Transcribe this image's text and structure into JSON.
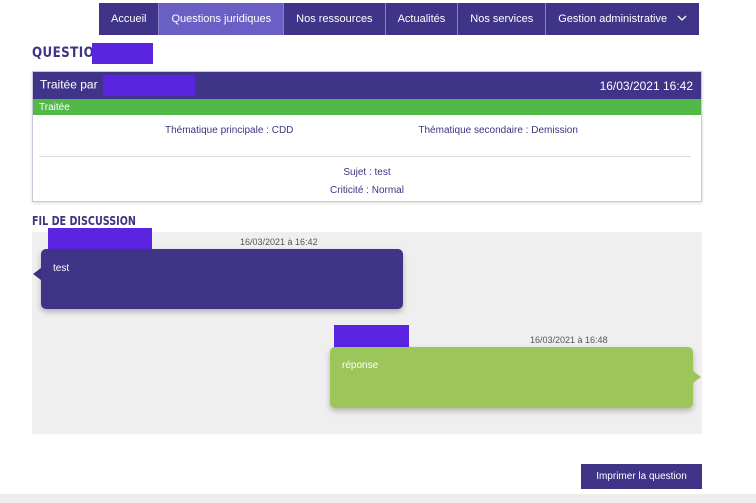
{
  "nav": {
    "items": [
      {
        "label": "Accueil"
      },
      {
        "label": "Questions juridiques"
      },
      {
        "label": "Nos ressources"
      },
      {
        "label": "Actualités"
      },
      {
        "label": "Nos services"
      },
      {
        "label": "Gestion administrative"
      }
    ],
    "active_index": 1,
    "chevron": "chevron-down-icon"
  },
  "question": {
    "title": "QUESTION",
    "handled_by_label": "Traitée par",
    "datetime": "16/03/2021 16:42",
    "status": "Traitée",
    "theme_main": "Thématique principale : CDD",
    "theme_secondary": "Thématique secondaire : Demission",
    "subject": "Sujet : test",
    "criticity": "Criticité : Normal"
  },
  "discussion": {
    "title": "FIL DE DISCUSSION",
    "messages": [
      {
        "timestamp": "16/03/2021 à 16:42",
        "text": "test"
      },
      {
        "timestamp": "16/03/2021 à 16:48",
        "text": "réponse"
      }
    ]
  },
  "actions": {
    "print_label": "Imprimer la question"
  },
  "colors": {
    "primary": "#3f3488",
    "active_nav": "#6a5fc4",
    "status_green": "#52b848",
    "reply_green": "#9dc65a",
    "redaction": "#5b24e0"
  }
}
